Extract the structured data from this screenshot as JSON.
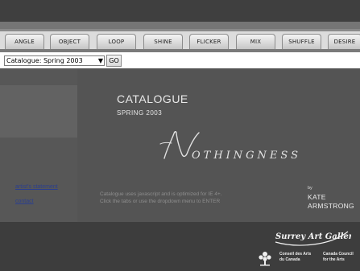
{
  "tabs": [
    "ANGLE",
    "OBJECT",
    "LOOP",
    "SHINE",
    "FLICKER",
    "MIX",
    "SHUFFLE",
    "DESIRE"
  ],
  "dropdown": {
    "selected": "Catalogue: Spring 2003",
    "arrow_icon": "chevron-down-icon"
  },
  "go_button": "GO",
  "sidebar": {
    "statement_link": "artist's statement",
    "contact_link": "contact"
  },
  "main": {
    "title": "CATALOGUE",
    "subtitle": "SPRING 2003",
    "logo_text": "OTHINGNESS",
    "info_line1": "Catalogue uses javascript and is optimized for IE 4+.",
    "info_line2": "Click the tabs or use the dropdown menu to ENTER",
    "by_label": "by",
    "artist_first": "KATE",
    "artist_last": "ARMSTRONG"
  },
  "footer": {
    "gallery_logo": "Surrey Art Gallery",
    "council_fr_1": "Conseil des Arts",
    "council_fr_2": "du Canada",
    "council_en_1": "Canada Council",
    "council_en_2": "for the Arts"
  },
  "colors": {
    "background": "#3d3d3d",
    "panel": "#545454",
    "link": "#2b3f8e",
    "tab": "#dcdcdc"
  }
}
